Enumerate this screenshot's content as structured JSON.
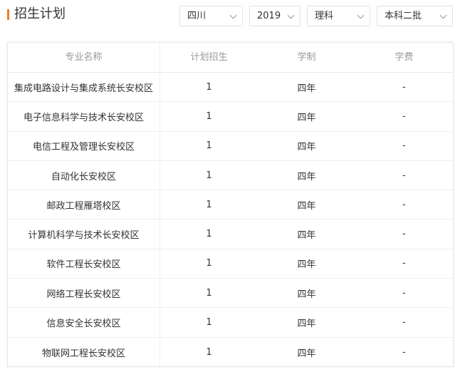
{
  "page": {
    "title": "招生计划"
  },
  "filters": {
    "province": "四川",
    "year": "2019",
    "subject": "理科",
    "batch": "本科二批"
  },
  "table": {
    "headers": [
      "专业名称",
      "计划招生",
      "学制",
      "学费"
    ],
    "rows": [
      [
        "集成电路设计与集成系统长安校区",
        "1",
        "四年",
        "-"
      ],
      [
        "电子信息科学与技术长安校区",
        "1",
        "四年",
        "-"
      ],
      [
        "电信工程及管理长安校区",
        "1",
        "四年",
        "-"
      ],
      [
        "自动化长安校区",
        "1",
        "四年",
        "-"
      ],
      [
        "邮政工程雁塔校区",
        "1",
        "四年",
        "-"
      ],
      [
        "计算机科学与技术长安校区",
        "1",
        "四年",
        "-"
      ],
      [
        "软件工程长安校区",
        "1",
        "四年",
        "-"
      ],
      [
        "网络工程长安校区",
        "1",
        "四年",
        "-"
      ],
      [
        "信息安全长安校区",
        "1",
        "四年",
        "-"
      ],
      [
        "物联网工程长安校区",
        "1",
        "四年",
        "-"
      ]
    ]
  }
}
